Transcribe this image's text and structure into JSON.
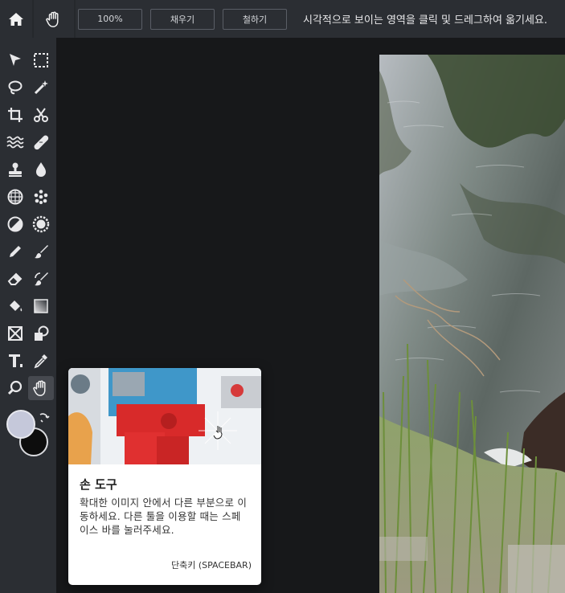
{
  "topbar": {
    "zoom_label": "100%",
    "fill_label": "채우기",
    "fit_label": "철하기",
    "hint": "시각적으로 보이는 영역을 클릭 및 드레그하여 옮기세요."
  },
  "tools": [
    {
      "name": "move-tool",
      "icon": "arrow-cursor-icon"
    },
    {
      "name": "marquee-tool",
      "icon": "dashed-rectangle-icon"
    },
    {
      "name": "lasso-tool",
      "icon": "lasso-icon"
    },
    {
      "name": "magic-wand-tool",
      "icon": "magic-wand-icon"
    },
    {
      "name": "crop-tool",
      "icon": "crop-icon"
    },
    {
      "name": "cut-tool",
      "icon": "scissors-icon"
    },
    {
      "name": "liquify-tool",
      "icon": "waves-icon"
    },
    {
      "name": "heal-tool",
      "icon": "bandage-icon"
    },
    {
      "name": "stamp-tool",
      "icon": "stamp-icon"
    },
    {
      "name": "blur-tool",
      "icon": "droplet-icon"
    },
    {
      "name": "sponge-tool",
      "icon": "grid-circle-icon"
    },
    {
      "name": "pattern-tool",
      "icon": "dots-cluster-icon"
    },
    {
      "name": "dodge-burn-tool",
      "icon": "half-circle-icon"
    },
    {
      "name": "sharpen-tool",
      "icon": "gear-circle-icon"
    },
    {
      "name": "pencil-tool",
      "icon": "pencil-icon"
    },
    {
      "name": "brush-tool",
      "icon": "brush-icon"
    },
    {
      "name": "eraser-tool",
      "icon": "eraser-icon"
    },
    {
      "name": "clone-brush-tool",
      "icon": "replace-brush-icon"
    },
    {
      "name": "fill-tool",
      "icon": "paint-bucket-icon"
    },
    {
      "name": "gradient-tool",
      "icon": "gradient-icon"
    },
    {
      "name": "frame-tool",
      "icon": "frame-icon"
    },
    {
      "name": "shape-tool",
      "icon": "shapes-icon"
    },
    {
      "name": "text-tool",
      "icon": "text-icon"
    },
    {
      "name": "eyedropper-tool",
      "icon": "eyedropper-icon"
    },
    {
      "name": "zoom-tool",
      "icon": "magnifier-icon"
    },
    {
      "name": "hand-tool",
      "icon": "hand-icon"
    }
  ],
  "colors": {
    "foreground": "#c5c8da",
    "background": "#0d0d0d",
    "accent_active": "#46494f"
  },
  "tooltip": {
    "title": "손 도구",
    "description": "확대한 이미지 안에서 다른 부분으로 이동하세요. 다른 툴을 이용할 때는 스페이스 바를 눌러주세요.",
    "shortcut": "단축키 (SPACEBAR)"
  }
}
